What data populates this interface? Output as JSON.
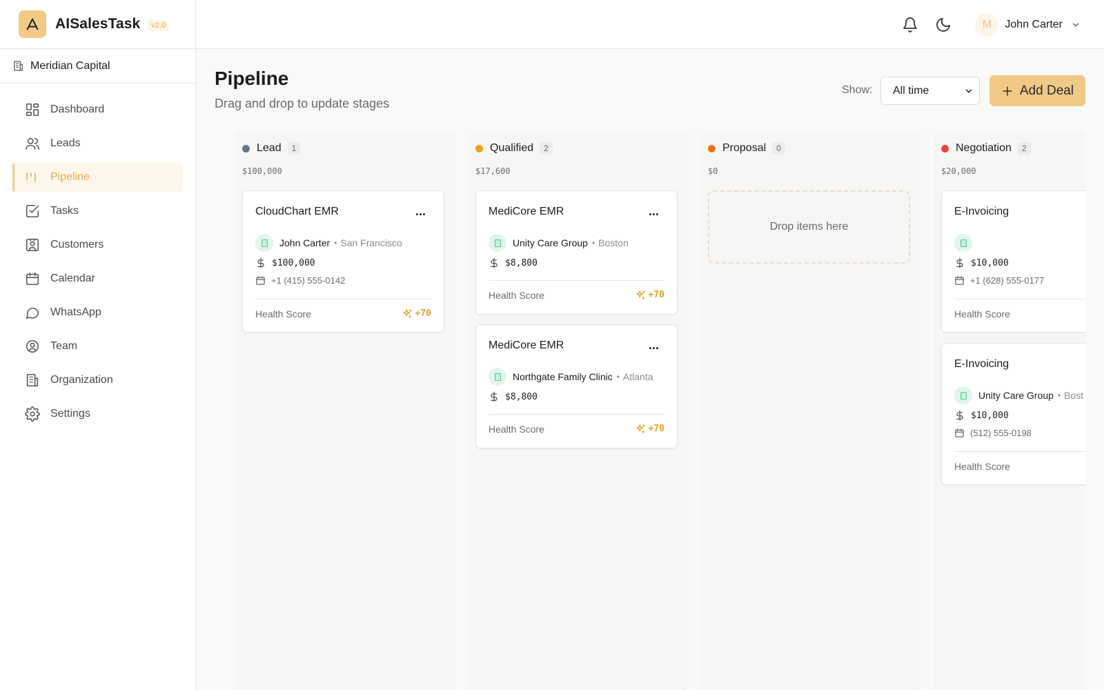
{
  "app": {
    "name": "AISalesTask",
    "version": "v2.0"
  },
  "org": {
    "name": "Meridian Capital"
  },
  "sidebar": {
    "items": [
      {
        "label": "Dashboard",
        "icon": "dashboard-icon"
      },
      {
        "label": "Leads",
        "icon": "users-icon"
      },
      {
        "label": "Pipeline",
        "icon": "pipeline-icon",
        "active": true
      },
      {
        "label": "Tasks",
        "icon": "checkbox-icon"
      },
      {
        "label": "Customers",
        "icon": "contact-icon"
      },
      {
        "label": "Calendar",
        "icon": "calendar-icon"
      },
      {
        "label": "WhatsApp",
        "icon": "chat-icon"
      },
      {
        "label": "Team",
        "icon": "user-circle-icon"
      },
      {
        "label": "Organization",
        "icon": "building-icon"
      },
      {
        "label": "Settings",
        "icon": "gear-icon"
      }
    ]
  },
  "header": {
    "user": {
      "initial": "M",
      "name": "John Carter"
    }
  },
  "page": {
    "title": "Pipeline",
    "subtitle": "Drag and drop to update stages",
    "show_label": "Show:",
    "show_value": "All time",
    "add_label": "Add Deal"
  },
  "colors": {
    "accent": "#f0c987",
    "lead": "#64748b",
    "qualified": "#f59e0b",
    "proposal": "#f97316",
    "negotiation": "#ef4444",
    "health": "#e3a11e"
  },
  "columns": [
    {
      "name": "Lead",
      "count": "1",
      "total": "$100,000",
      "cards": [
        {
          "title": "CloudChart EMR",
          "menu": "...",
          "company": "John Carter",
          "sep": "•",
          "city": "San Francisco",
          "amount": "$100,000",
          "phone": "+1 (415) 555-0142",
          "health_label": "Health Score",
          "health_value": "+70"
        }
      ]
    },
    {
      "name": "Qualified",
      "count": "2",
      "total": "$17,600",
      "cards": [
        {
          "title": "MediCore EMR",
          "menu": "...",
          "company": "Unity Care Group",
          "sep": "•",
          "city": "Boston",
          "amount": "$8,800",
          "health_label": "Health Score",
          "health_value": "+70"
        },
        {
          "title": "MediCore EMR",
          "menu": "...",
          "company": "Northgate Family Clinic",
          "sep": "•",
          "city": "Atlanta",
          "amount": "$8,800",
          "health_label": "Health Score",
          "health_value": "+70"
        }
      ]
    },
    {
      "name": "Proposal",
      "count": "0",
      "total": "$0",
      "dropzone": "Drop items here"
    },
    {
      "name": "Negotiation",
      "count": "2",
      "total": "$20,000",
      "cards": [
        {
          "title": "E-Invoicing",
          "amount": "$10,000",
          "phone": "+1 (628) 555-0177",
          "health_label": "Health Score"
        },
        {
          "title": "E-Invoicing",
          "company": "Unity Care Group",
          "sep": "•",
          "city": "Bost",
          "amount": "$10,000",
          "phone": "(512) 555-0198",
          "health_label": "Health Score"
        }
      ]
    }
  ]
}
